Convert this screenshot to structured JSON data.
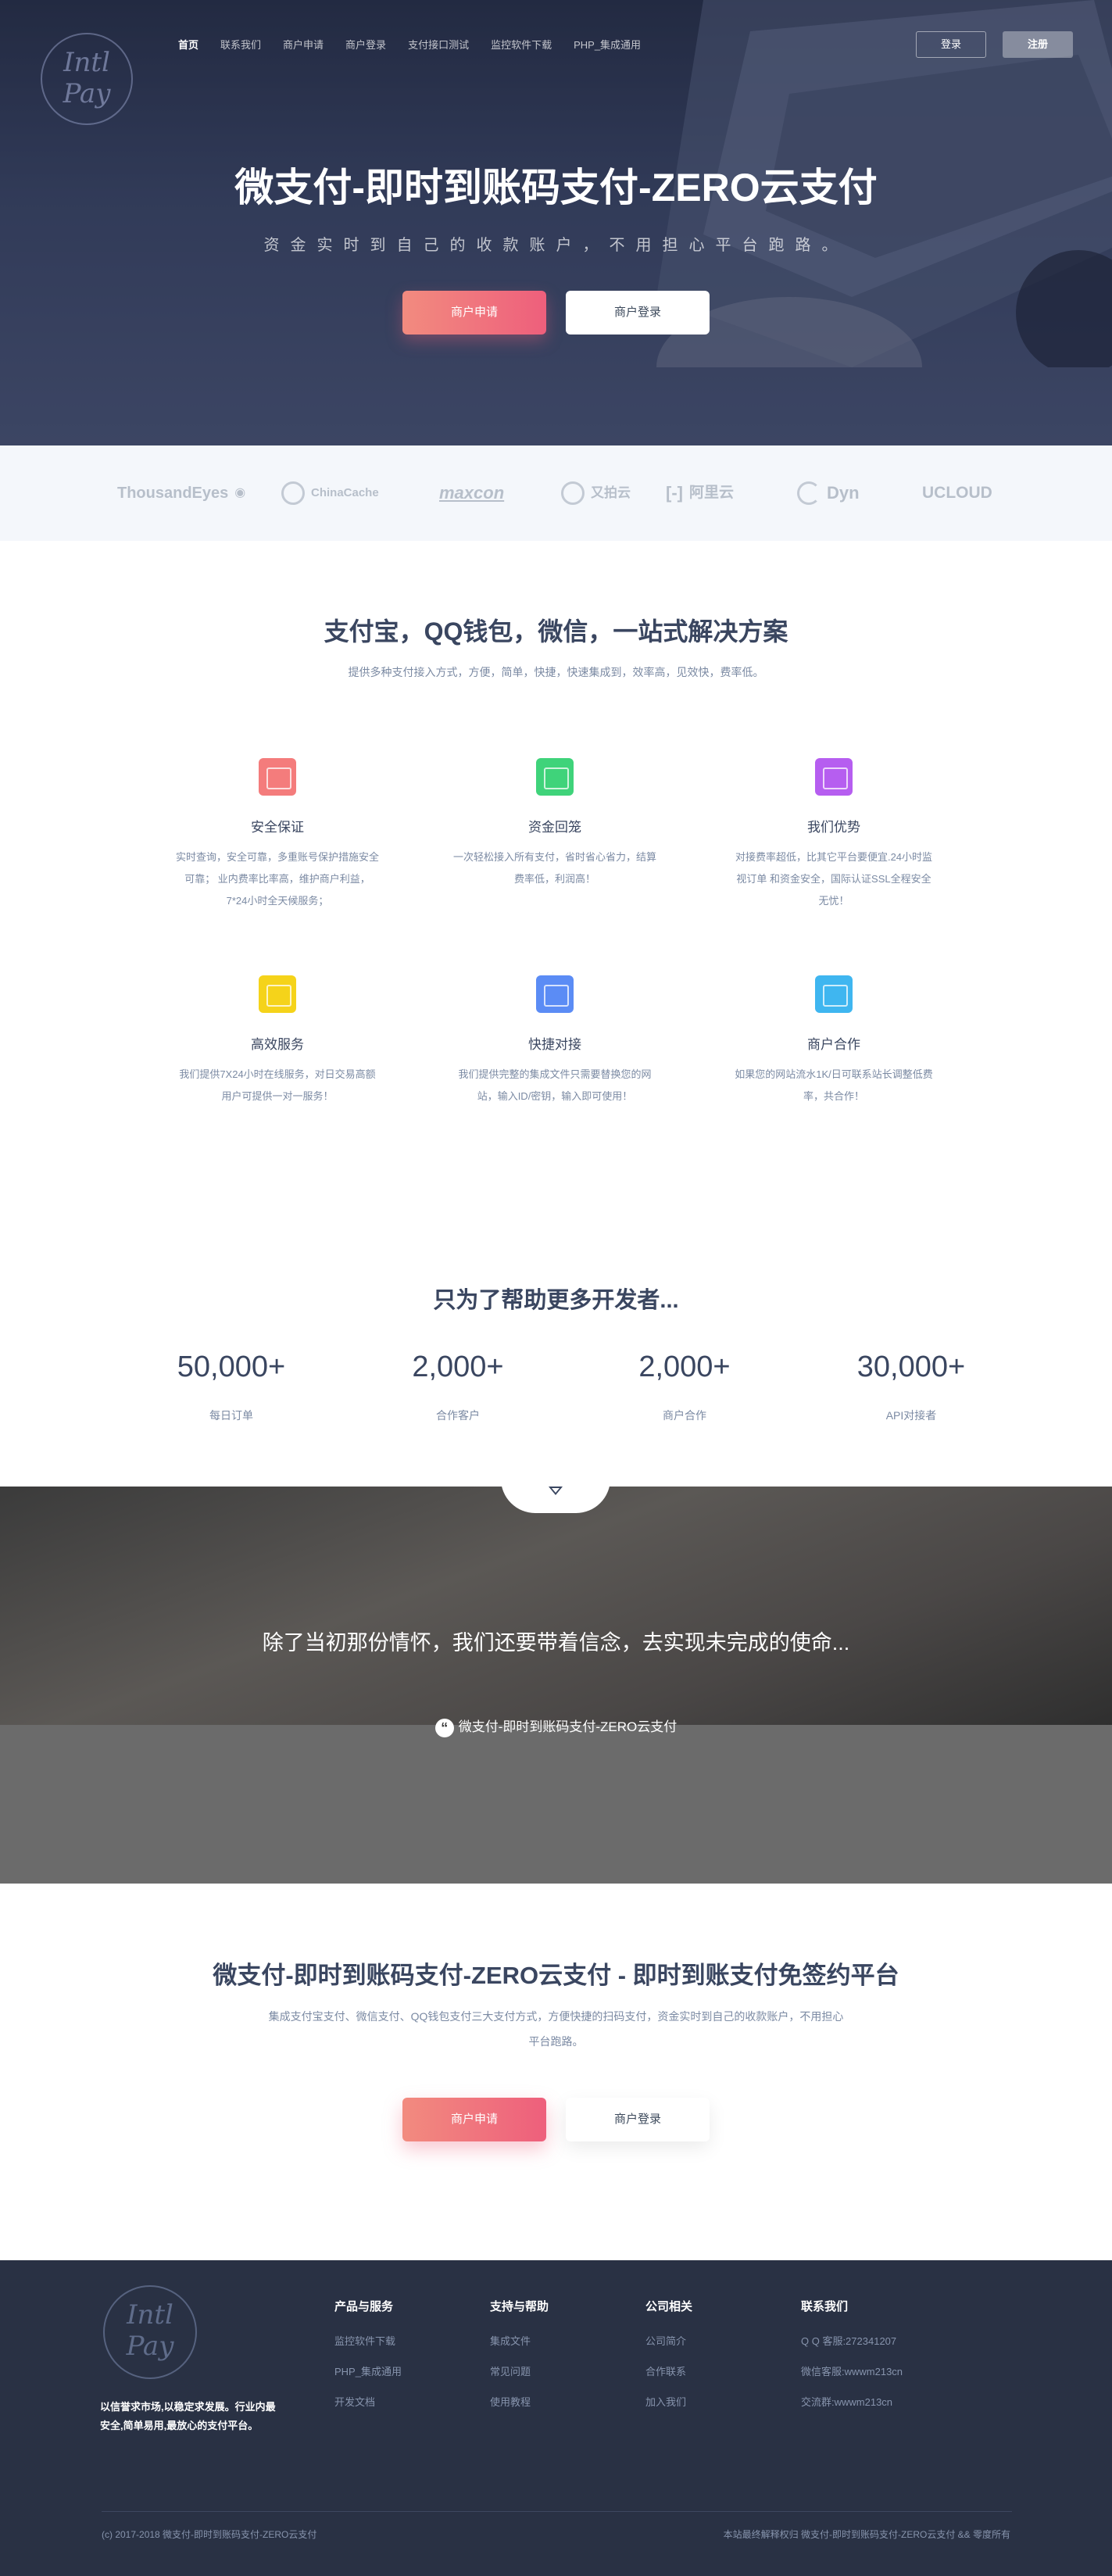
{
  "nav": {
    "items": [
      "首页",
      "联系我们",
      "商户申请",
      "商户登录",
      "支付接口测试",
      "监控软件下载",
      "PHP_集成通用"
    ],
    "login": "登录",
    "register": "注册"
  },
  "hero": {
    "title": "微支付-即时到账码支付-ZERO云支付",
    "subtitle": "资金实时到自己的收款账户，不用担心平台跑路。",
    "apply_button": "商户申请",
    "login_button": "商户登录"
  },
  "partners": [
    "ThousandEyes",
    "ChinaCache",
    "maxcon",
    "又拍云",
    "阿里云",
    "Dyn",
    "UCLOUD"
  ],
  "solutions": {
    "title": "支付宝，QQ钱包，微信，一站式解决方案",
    "subtitle": "提供多种支付接入方式，方便，简单，快捷，快速集成到，效率高，见效快，费率低。",
    "features": [
      {
        "title": "安全保证",
        "desc": "实时查询，安全可靠，多重账号保护措施安全可靠；  业内费率比率高，维护商户利益，7*24小时全天候服务；",
        "color": "#f47c7c",
        "icon": "document-icon"
      },
      {
        "title": "资金回笼",
        "desc": "一次轻松接入所有支付，省时省心省力，结算费率低，利润高！",
        "color": "#3fd37a",
        "icon": "code-icon"
      },
      {
        "title": "我们优势",
        "desc": "对接费率超低，比其它平台要便宜.24小时监视订单 和资金安全，国际认证SSL全程安全无忧！",
        "color": "#b65ef0",
        "icon": "layout-icon"
      },
      {
        "title": "高效服务",
        "desc": "我们提供7X24小时在线服务，对日交易高额用户可提供一对一服务！",
        "color": "#f5d31a",
        "icon": "chart-icon"
      },
      {
        "title": "快捷对接",
        "desc": "我们提供完整的集成文件只需要替换您的网站，输入ID/密钥，输入即可使用！",
        "color": "#5b8cf5",
        "icon": "edit-icon"
      },
      {
        "title": "商户合作",
        "desc": "如果您的网站流水1K/日可联系站长调整低费率，共合作！",
        "color": "#3fb6f0",
        "icon": "expand-icon"
      }
    ]
  },
  "stats": {
    "title": "只为了帮助更多开发者...",
    "items": [
      {
        "number": "50,000+",
        "label": "每日订单"
      },
      {
        "number": "2,000+",
        "label": "合作客户"
      },
      {
        "number": "2,000+",
        "label": "商户合作"
      },
      {
        "number": "30,000+",
        "label": "API对接者"
      }
    ]
  },
  "quote": {
    "text": "除了当初那份情怀，我们还要带着信念，去实现未完成的使命...",
    "source": "微支付-即时到账码支付-ZERO云支付"
  },
  "cta": {
    "title": "微支付-即时到账码支付-ZERO云支付 - 即时到账支付免签约平台",
    "desc_line1": "集成支付宝支付、微信支付、QQ钱包支付三大支付方式，方便快捷的扫码支付，资金实时到自己的收款账户，不用担心",
    "desc_line2": "平台跑路。",
    "apply_button": "商户申请",
    "login_button": "商户登录"
  },
  "footer": {
    "about": "以信誉求市场,以稳定求发展。行业内最安全,简单易用,最放心的支付平台。",
    "columns": [
      {
        "title": "产品与服务",
        "items": [
          "监控软件下载",
          "PHP_集成通用",
          "开发文档"
        ]
      },
      {
        "title": "支持与帮助",
        "items": [
          "集成文件",
          "常见问题",
          "使用教程"
        ]
      },
      {
        "title": "公司相关",
        "items": [
          "公司简介",
          "合作联系",
          "加入我们"
        ]
      },
      {
        "title": "联系我们",
        "items": [
          "Q Q 客服:272341207",
          "微信客服:wwwm213cn",
          "交流群:wwwm213cn"
        ]
      }
    ],
    "copyright": "(c) 2017-2018 微支付-即时到账码支付-ZERO云支付",
    "rights": "本站最终解释权归 微支付-即时到账码支付-ZERO云支付 && 零度所有"
  }
}
